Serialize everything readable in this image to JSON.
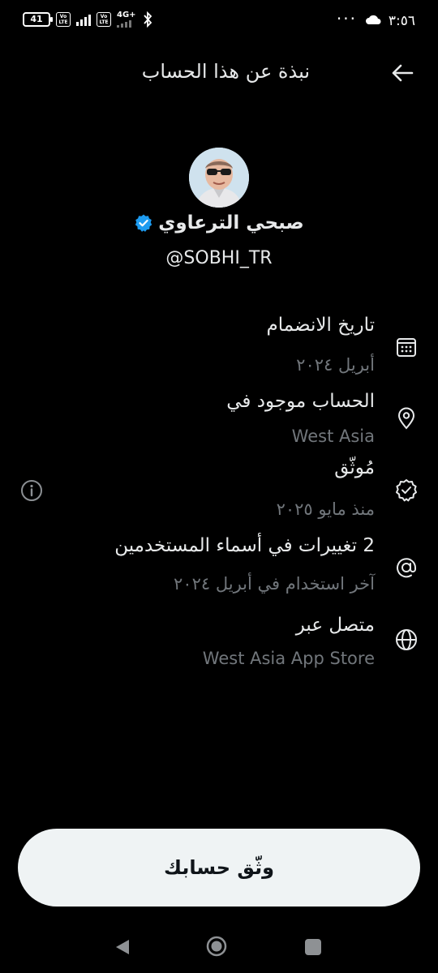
{
  "status_bar": {
    "time": "٣:٥٦",
    "battery": "41",
    "volte1": "Vo LTE",
    "volte2": "Vo LTE",
    "network": "4G+",
    "overflow": "···"
  },
  "header": {
    "title": "نبذة عن هذا الحساب"
  },
  "profile": {
    "display_name": "صبحي الترعاوي",
    "handle": "@SOBHI_TR"
  },
  "info_rows": [
    {
      "title": "تاريخ الانضمام",
      "value": "أبريل ٢٠٢٤",
      "icon": "calendar-icon"
    },
    {
      "title": "الحساب موجود في",
      "value": "West Asia",
      "icon": "location-pin-icon"
    },
    {
      "title": "مُوثّق",
      "value": "منذ مايو ٢٠٢٥",
      "icon": "verified-badge-icon"
    },
    {
      "title": "2 تغييرات في أسماء المستخدمين",
      "value": "آخر استخدام في أبريل ٢٠٢٤",
      "icon": "at-sign-icon"
    },
    {
      "title": "متصل عبر",
      "value": "West Asia App Store",
      "icon": "globe-icon"
    }
  ],
  "verify_button": {
    "label": "وثّق حسابك"
  },
  "colors": {
    "background": "#000000",
    "primary_text": "#e7e9ea",
    "secondary_text": "#71767b",
    "verified_blue": "#1d9bf0",
    "button_bg": "#eff3f4"
  }
}
